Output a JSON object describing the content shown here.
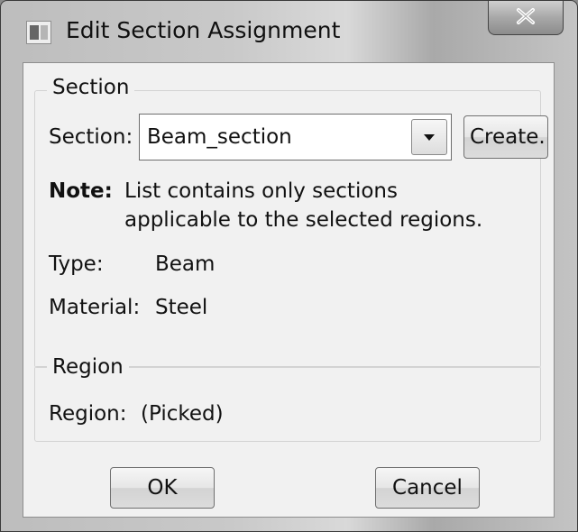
{
  "window": {
    "title": "Edit Section Assignment",
    "icons": {
      "app": "dialog-app-icon",
      "close": "close-icon"
    }
  },
  "section_group": {
    "legend": "Section",
    "section_label": "Section:",
    "section_value": "Beam_section",
    "create_button": "Create...",
    "note_label": "Note:",
    "note_line1": "List contains only sections",
    "note_line2": "applicable to the selected regions.",
    "type_label": "Type:",
    "type_value": "Beam",
    "material_label": "Material:",
    "material_value": "Steel"
  },
  "region_group": {
    "legend": "Region",
    "region_label": "Region:",
    "region_value": "(Picked)"
  },
  "buttons": {
    "ok": "OK",
    "cancel": "Cancel"
  }
}
